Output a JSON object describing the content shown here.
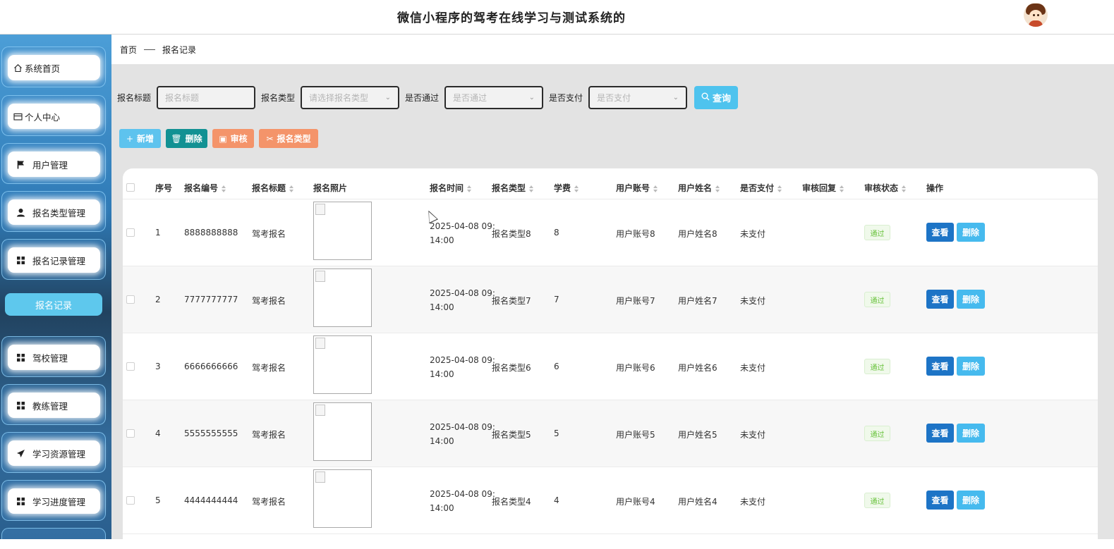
{
  "header": {
    "title": "微信小程序的驾考在线学习与测试系统的"
  },
  "sidebar": {
    "items": [
      {
        "label": "系统首页",
        "icon": "home-icon"
      },
      {
        "label": "个人中心",
        "icon": "card-icon"
      },
      {
        "label": "用户管理",
        "icon": "flag-icon"
      },
      {
        "label": "报名类型管理",
        "icon": "user-icon"
      },
      {
        "label": "报名记录管理",
        "icon": "grid-icon"
      },
      {
        "label": "驾校管理",
        "icon": "grid-icon"
      },
      {
        "label": "教练管理",
        "icon": "grid-icon"
      },
      {
        "label": "学习资源管理",
        "icon": "send-icon"
      },
      {
        "label": "学习进度管理",
        "icon": "grid-icon"
      }
    ],
    "active_sub": "报名记录"
  },
  "breadcrumb": {
    "home": "首页",
    "current": "报名记录"
  },
  "filters": {
    "title_label": "报名标题",
    "title_placeholder": "报名标题",
    "type_label": "报名类型",
    "type_placeholder": "请选择报名类型",
    "pass_label": "是否通过",
    "pass_placeholder": "是否通过",
    "pay_label": "是否支付",
    "pay_placeholder": "是否支付",
    "search_label": "查询"
  },
  "actions": {
    "add": "新增",
    "delete": "删除",
    "review": "审核",
    "type": "报名类型"
  },
  "table": {
    "headers": {
      "index": "序号",
      "code": "报名编号",
      "title": "报名标题",
      "photo": "报名照片",
      "time": "报名时间",
      "type": "报名类型",
      "fee": "学费",
      "account": "用户账号",
      "name": "用户姓名",
      "paid": "是否支付",
      "reply": "审核回复",
      "status": "审核状态",
      "ops": "操作"
    },
    "rows": [
      {
        "index": "1",
        "code": "8888888888",
        "title": "驾考报名",
        "time1": "2025-04-08 09:",
        "time2": "14:00",
        "type": "报名类型8",
        "fee": "8",
        "account": "用户账号8",
        "name": "用户姓名8",
        "paid": "未支付",
        "status": "通过"
      },
      {
        "index": "2",
        "code": "7777777777",
        "title": "驾考报名",
        "time1": "2025-04-08 09:",
        "time2": "14:00",
        "type": "报名类型7",
        "fee": "7",
        "account": "用户账号7",
        "name": "用户姓名7",
        "paid": "未支付",
        "status": "通过"
      },
      {
        "index": "3",
        "code": "6666666666",
        "title": "驾考报名",
        "time1": "2025-04-08 09:",
        "time2": "14:00",
        "type": "报名类型6",
        "fee": "6",
        "account": "用户账号6",
        "name": "用户姓名6",
        "paid": "未支付",
        "status": "通过"
      },
      {
        "index": "4",
        "code": "5555555555",
        "title": "驾考报名",
        "time1": "2025-04-08 09:",
        "time2": "14:00",
        "type": "报名类型5",
        "fee": "5",
        "account": "用户账号5",
        "name": "用户姓名5",
        "paid": "未支付",
        "status": "通过"
      },
      {
        "index": "5",
        "code": "4444444444",
        "title": "驾考报名",
        "time1": "2025-04-08 09:",
        "time2": "14:00",
        "type": "报名类型4",
        "fee": "4",
        "account": "用户账号4",
        "name": "用户姓名4",
        "paid": "未支付",
        "status": "通过"
      }
    ],
    "view_label": "查看",
    "delete_label": "删除"
  },
  "colors": {
    "accent": "#4ec3ee",
    "view_button": "#1d74c6",
    "add_button": "#5ec3ee",
    "delete_button": "#129193",
    "review_button": "#f4946a",
    "status_tag": "#67c23a"
  }
}
